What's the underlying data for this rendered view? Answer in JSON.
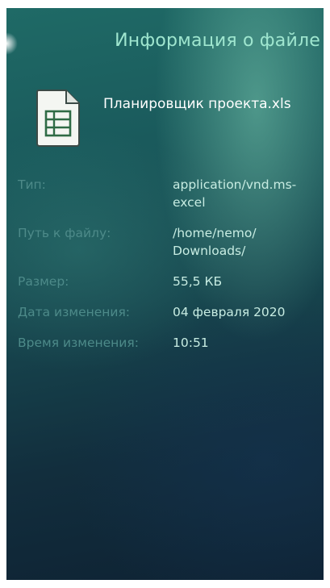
{
  "header": {
    "title": "Информация о файле"
  },
  "file": {
    "name": "Планировщик проекта.xls",
    "icon": "spreadsheet-icon"
  },
  "details": [
    {
      "label": "Тип:",
      "value": "application/vnd.ms-excel"
    },
    {
      "label": "Путь к файлу:",
      "value": "/home/nemo/ Downloads/"
    },
    {
      "label": "Размер:",
      "value": "55,5 КБ"
    },
    {
      "label": "Дата изменения:",
      "value": "04 февраля 2020"
    },
    {
      "label": "Время изменения:",
      "value": "10:51"
    }
  ],
  "colors": {
    "accent": "#9fe6cf",
    "label": "#4d8a89",
    "value": "#c7ece2"
  }
}
